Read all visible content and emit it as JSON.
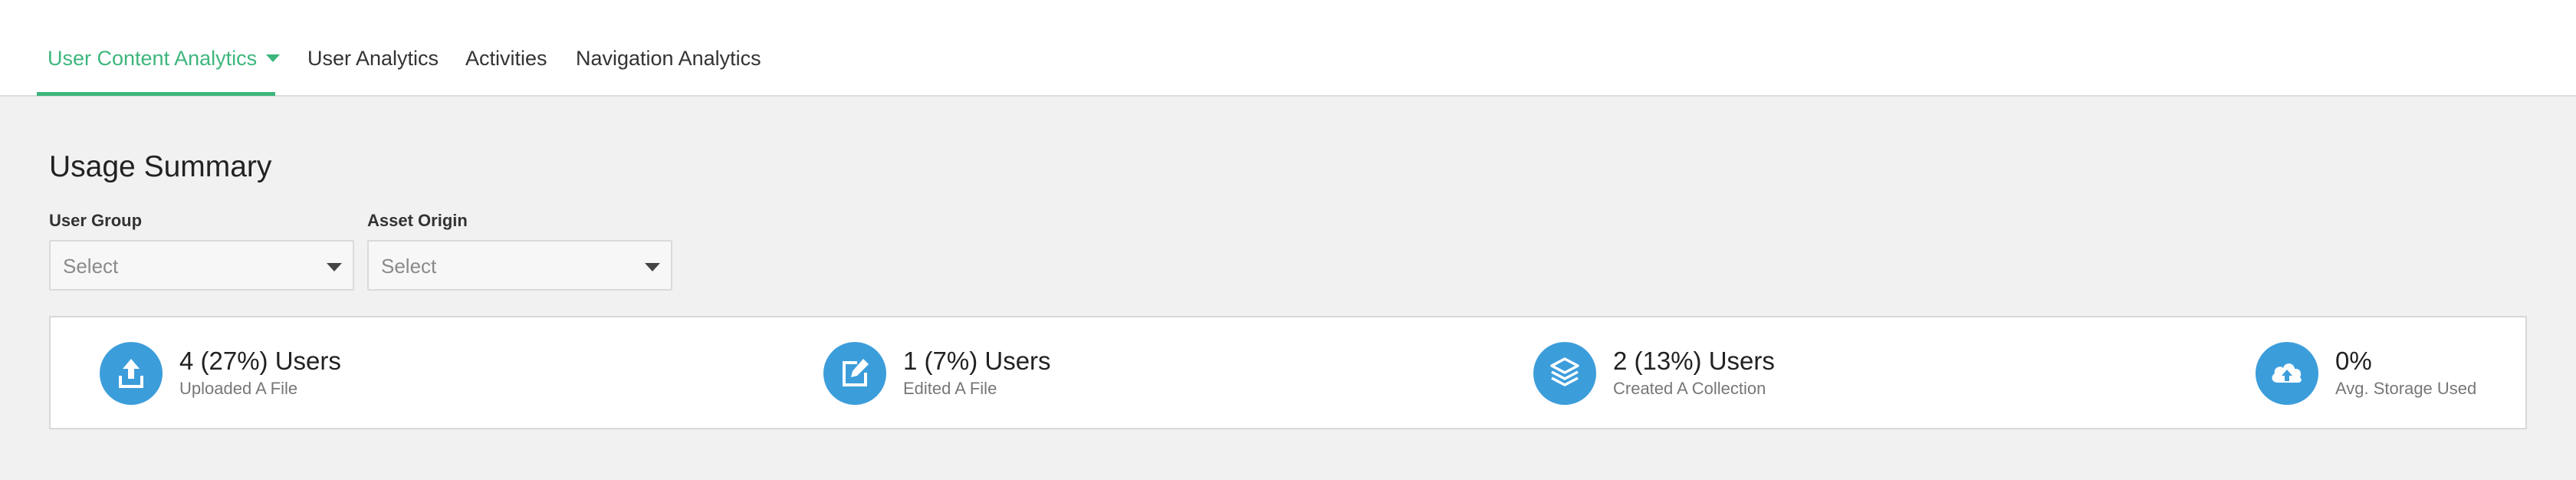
{
  "nav": {
    "tabs": [
      {
        "label": "User Content Analytics",
        "active": true
      },
      {
        "label": "User Analytics",
        "active": false
      },
      {
        "label": "Activities",
        "active": false
      },
      {
        "label": "Navigation Analytics",
        "active": false
      }
    ],
    "accent_color": "#3db67c"
  },
  "summary": {
    "title": "Usage Summary",
    "filters": [
      {
        "label": "User Group",
        "placeholder": "Select"
      },
      {
        "label": "Asset Origin",
        "placeholder": "Select"
      }
    ],
    "icon_color": "#3c9ddb",
    "stats": [
      {
        "icon": "upload-icon",
        "value": "4 (27%) Users",
        "label": "Uploaded A File"
      },
      {
        "icon": "edit-icon",
        "value": "1 (7%) Users",
        "label": "Edited A File"
      },
      {
        "icon": "layers-icon",
        "value": "2 (13%) Users",
        "label": "Created A Collection"
      },
      {
        "icon": "cloud-upload-icon",
        "value": "0%",
        "label": "Avg. Storage Used"
      }
    ]
  }
}
